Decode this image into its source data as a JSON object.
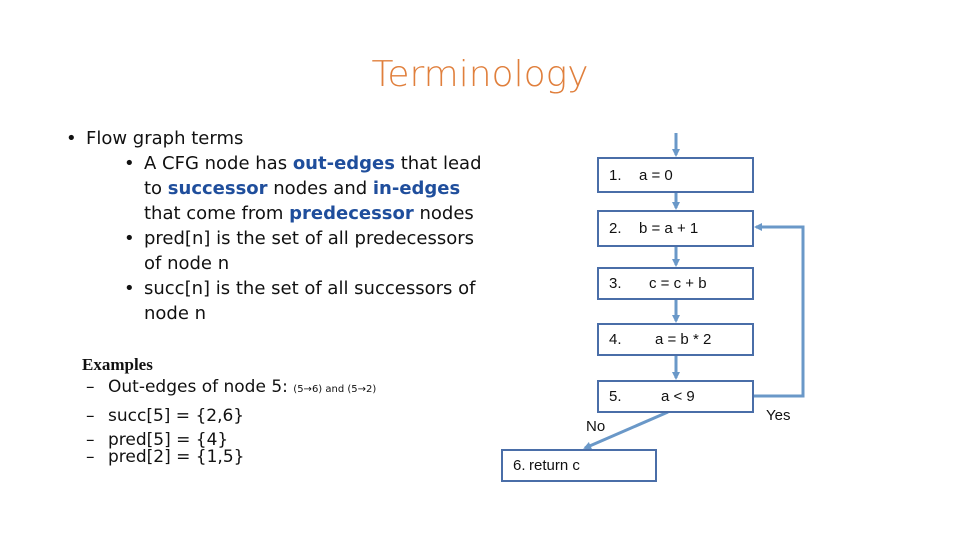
{
  "title": "Terminology",
  "bullets": {
    "main": "Flow graph terms",
    "sub": [
      {
        "parts": [
          {
            "t": "A CFG node has ",
            "hl": false
          },
          {
            "t": "out-edges",
            "hl": true
          },
          {
            "t": " that lead to ",
            "hl": false
          },
          {
            "t": "successor",
            "hl": true
          },
          {
            "t": " nodes and ",
            "hl": false
          },
          {
            "t": "in-edges",
            "hl": true
          },
          {
            "t": " that come from ",
            "hl": false
          },
          {
            "t": "predecessor",
            "hl": true
          },
          {
            "t": " nodes",
            "hl": false
          }
        ]
      },
      {
        "parts": [
          {
            "t": "pred[n] is the set of all predecessors of node n",
            "hl": false
          }
        ]
      },
      {
        "parts": [
          {
            "t": "succ[n] is the set of all successors of node n",
            "hl": false
          }
        ]
      }
    ]
  },
  "examples": {
    "heading": "Examples",
    "out_edges_label": "Out-edges of node 5: ",
    "out_edges_detail": "(5→6) and (5→2)",
    "succ5": "succ[5] =  {2,6}",
    "pred5": "pred[5] =  {4}",
    "pred2": "pred[2] =  {1,5}",
    "dash": "–"
  },
  "cfg": {
    "colors": {
      "edge": "#6a98c8",
      "border": "#4a6ea8",
      "highlight": "#1f4e9c",
      "title": "#e07f3c"
    },
    "nodes": [
      {
        "num": "1.",
        "stmt": "a = 0"
      },
      {
        "num": "2.",
        "stmt": "b = a + 1"
      },
      {
        "num": "3.",
        "stmt": "c = c + b"
      },
      {
        "num": "4.",
        "stmt": "a = b  * 2"
      },
      {
        "num": "5.",
        "stmt": "a < 9"
      },
      {
        "num": "6.",
        "stmt": "return c"
      }
    ],
    "edge_labels": {
      "yes": "Yes",
      "no": "No"
    }
  }
}
